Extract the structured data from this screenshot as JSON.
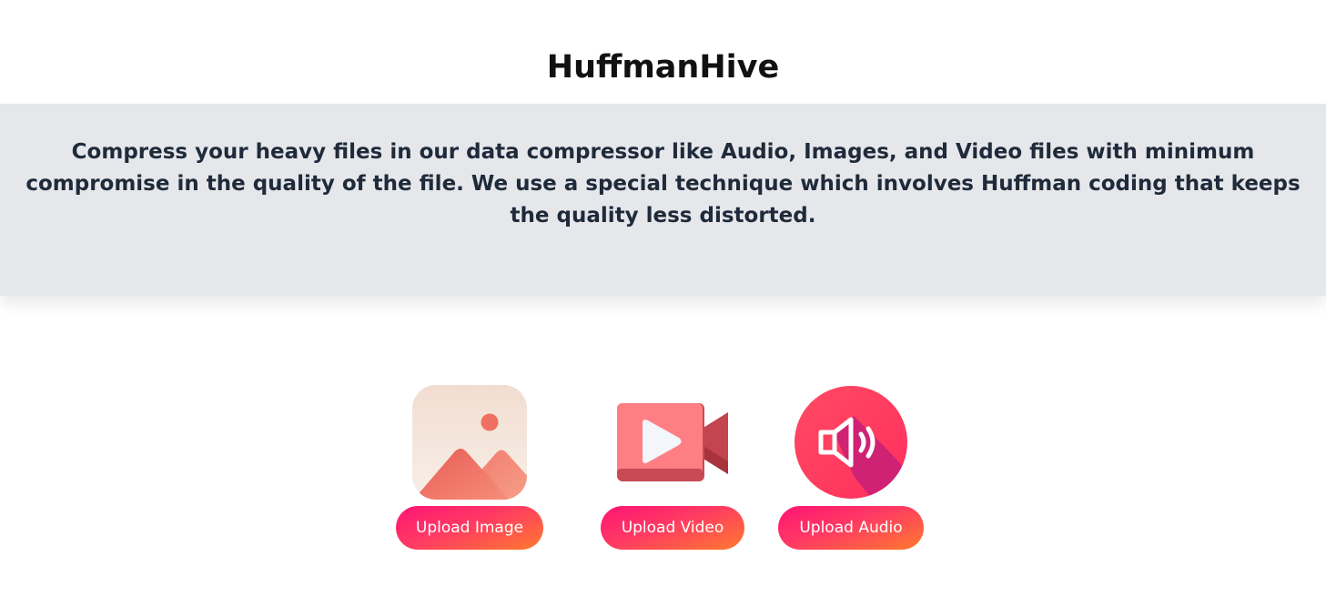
{
  "header": {
    "title": "HuffmanHive"
  },
  "hero": {
    "description": "Compress your heavy files in our data compressor like Audio, Images, and Video files with minimum compromise in the quality of the file. We use a special technique which involves Huffman coding that keeps the quality less distorted."
  },
  "uploads": [
    {
      "icon": "image-icon",
      "label": "Upload Image"
    },
    {
      "icon": "video-camera-icon",
      "label": "Upload Video"
    },
    {
      "icon": "speaker-icon",
      "label": "Upload Audio"
    }
  ],
  "colors": {
    "hero_background": "#e5e7eb",
    "button_gradient_start": "#ff1474",
    "button_gradient_end": "#ff7a2e",
    "hero_text": "#1f2a3a"
  }
}
